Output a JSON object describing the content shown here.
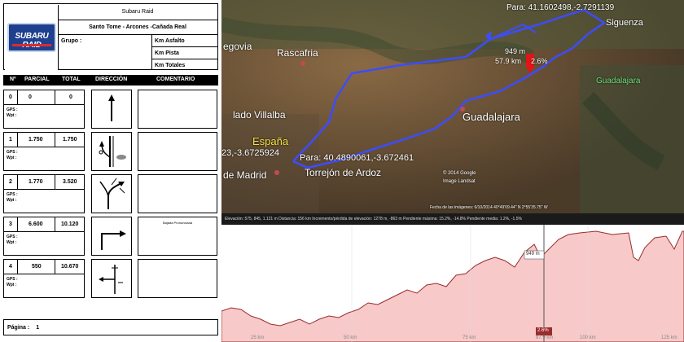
{
  "roadbook": {
    "event": "Subaru Raid",
    "logo_text": "SUBARU RAID",
    "route": "Santo Tome - Arcones -Cañada Real",
    "grupo_label": "Grupo :",
    "km_asfalto_label": "Km Asfalto",
    "km_pista_label": "Km Pista",
    "km_totales_label": "Km Totales",
    "columns": {
      "n": "Nº",
      "parcial": "PARCIAL",
      "total": "TOTAL",
      "direccion": "DIRECCIÓN",
      "comentario": "COMENTARIO"
    },
    "gps_label": "GPS :",
    "wpt_label": "Wpt :",
    "rows": [
      {
        "n": "0",
        "parcial": "0",
        "total": "0",
        "comment": "",
        "icon": "straight-arrow-icon"
      },
      {
        "n": "1",
        "parcial": "1.750",
        "total": "1.750",
        "comment": "",
        "icon": "road-junction-icon"
      },
      {
        "n": "2",
        "parcial": "1.770",
        "total": "3.520",
        "comment": "",
        "icon": "fork-right-icon"
      },
      {
        "n": "3",
        "parcial": "6.600",
        "total": "10.120",
        "comment": "Bajada Pronunciada",
        "icon": "turn-right-icon"
      },
      {
        "n": "4",
        "parcial": "550",
        "total": "10.670",
        "comment": "",
        "icon": "turn-left-icon"
      }
    ],
    "pagina_label": "Página :",
    "pagina_value": "1"
  },
  "map": {
    "labels": {
      "segovia": "egovia",
      "rascafria": "Rascafria",
      "siguenza": "Siguenza",
      "guadalajara_river": "Guadalajara",
      "guadalajara": "Guadalajara",
      "villalba": "lado Villalba",
      "espana": "España",
      "madrid": "de Madrid",
      "torrejon": "Torrejón de Ardoz",
      "coord_left": "23,-3.6725924",
      "para_top": "Para: 41.1602498,-2.7291139",
      "para_bottom": "Para: 40.4890061,-3.672461",
      "marker_elev": "949 m",
      "marker_dist": "57.9 km",
      "marker_pct": "2.6%",
      "copyright": "© 2014 Google",
      "image": "Image Landsat",
      "footer": "Fecha de las imágenes: 6/10/2014   40°49'09.44\" N   2°55'35.75\" W"
    },
    "colors": {
      "route": "#3d4cff",
      "marker": "#e01515",
      "terrain": "#6b5238"
    }
  },
  "elevation": {
    "stats": "Elevación: 575, 845, 1.121 m   Distancia: 156 km   Incremento/pérdida de elevación: 1278 m, -863 m   Pendiente máxima: 15.2%, -14.8%   Pendiente media: 1.2%, -1.5%",
    "marker_value": "949 m",
    "cursor_pct": "2.6%",
    "x_ticks": [
      "25 km",
      "50 km",
      "75 km",
      "87.9 km",
      "100 km",
      "125 km"
    ],
    "fill_color": "#f7c9c9",
    "line_color": "#9a2c2c"
  }
}
